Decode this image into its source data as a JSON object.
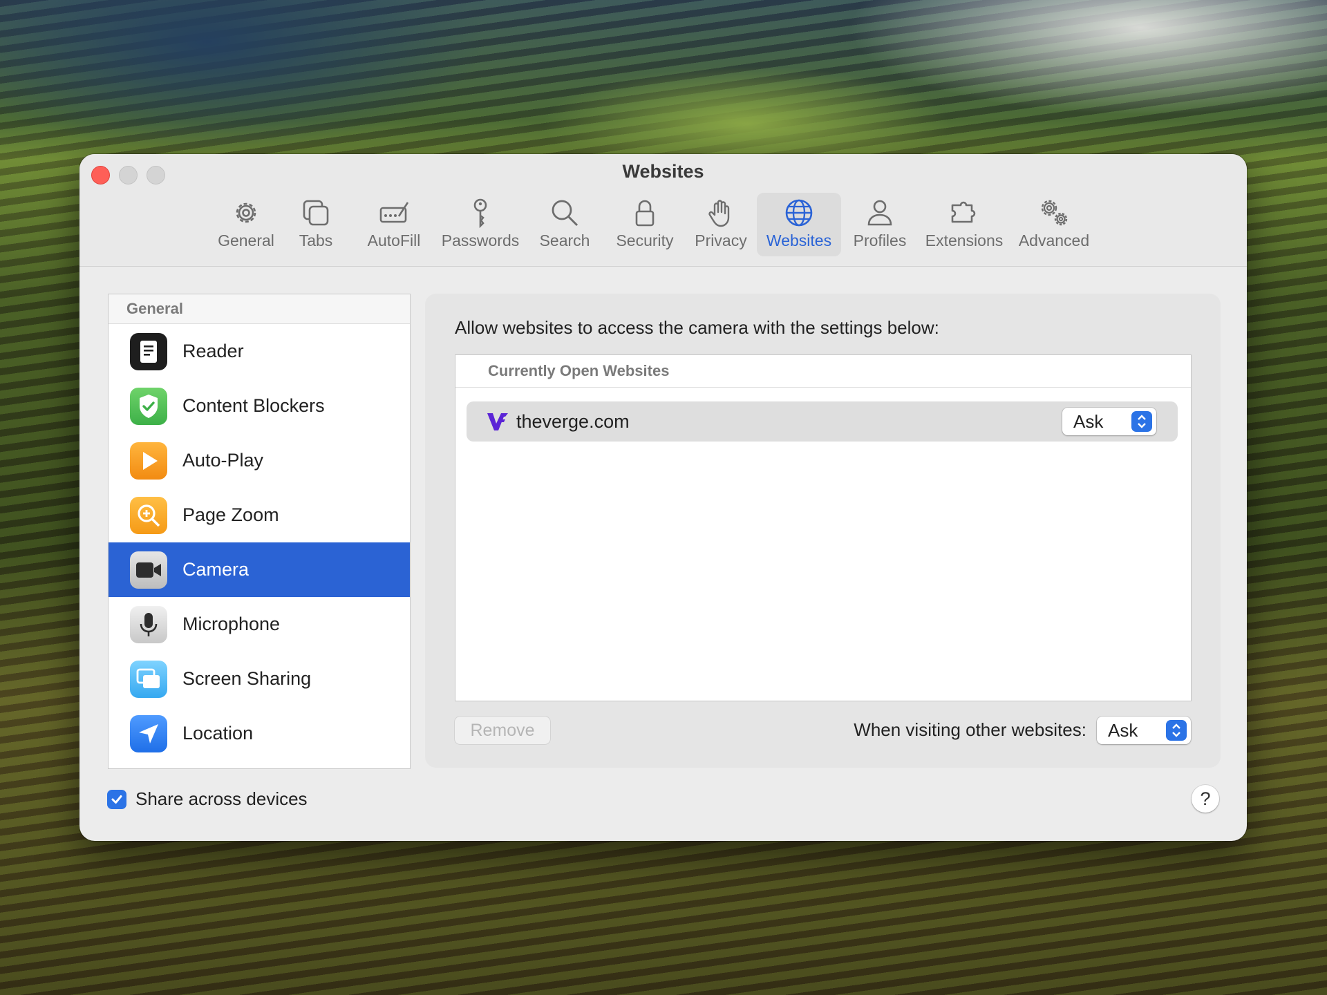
{
  "window": {
    "title": "Websites"
  },
  "toolbar": {
    "tabs": [
      {
        "label": "General",
        "icon": "gear-icon"
      },
      {
        "label": "Tabs",
        "icon": "tabs-icon"
      },
      {
        "label": "AutoFill",
        "icon": "autofill-icon"
      },
      {
        "label": "Passwords",
        "icon": "key-icon"
      },
      {
        "label": "Search",
        "icon": "search-icon"
      },
      {
        "label": "Security",
        "icon": "lock-icon"
      },
      {
        "label": "Privacy",
        "icon": "hand-icon"
      },
      {
        "label": "Websites",
        "icon": "globe-icon",
        "active": true
      },
      {
        "label": "Profiles",
        "icon": "person-icon"
      },
      {
        "label": "Extensions",
        "icon": "puzzle-icon"
      },
      {
        "label": "Advanced",
        "icon": "gears-icon"
      }
    ]
  },
  "sidebar": {
    "header": "General",
    "items": [
      {
        "label": "Reader",
        "icon": "reader-icon"
      },
      {
        "label": "Content Blockers",
        "icon": "shield-check-icon"
      },
      {
        "label": "Auto-Play",
        "icon": "play-icon"
      },
      {
        "label": "Page Zoom",
        "icon": "zoom-icon"
      },
      {
        "label": "Camera",
        "icon": "camera-icon",
        "selected": true
      },
      {
        "label": "Microphone",
        "icon": "microphone-icon"
      },
      {
        "label": "Screen Sharing",
        "icon": "screen-sharing-icon"
      },
      {
        "label": "Location",
        "icon": "location-arrow-icon"
      }
    ]
  },
  "content": {
    "description": "Allow websites to access the camera with the settings below:",
    "table_header": "Currently Open Websites",
    "sites": [
      {
        "name": "theverge.com",
        "setting": "Ask",
        "icon": "verge-logo-icon"
      }
    ],
    "remove_label": "Remove",
    "other_label": "When visiting other websites:",
    "other_value": "Ask"
  },
  "footer": {
    "share_label": "Share across devices",
    "share_checked": true,
    "help_label": "?"
  },
  "colors": {
    "accent": "#2b63d4",
    "close": "#fe5f57",
    "verge": "#5b24d6"
  }
}
